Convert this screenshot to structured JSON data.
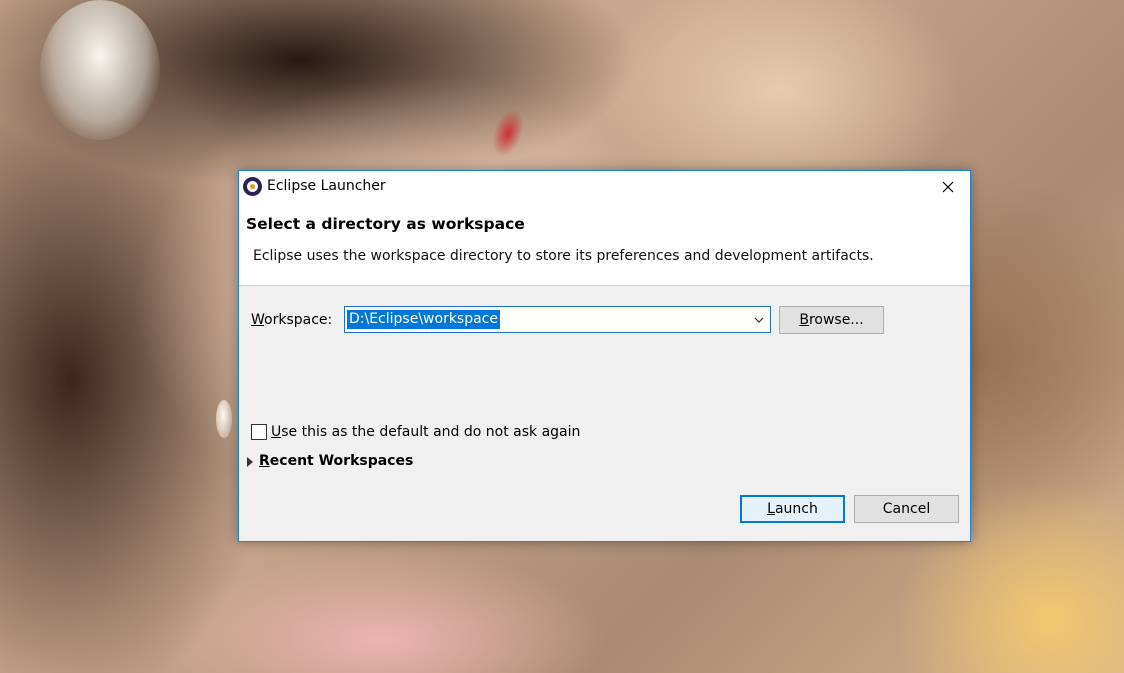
{
  "window": {
    "title": "Eclipse Launcher",
    "icon": "eclipse-icon",
    "close_icon": "close-icon",
    "accent_color": "#1883d7"
  },
  "header": {
    "title": "Select a directory as workspace",
    "description": "Eclipse uses the workspace directory to store its preferences and development artifacts."
  },
  "workspace": {
    "label_mnemonic": "W",
    "label_rest": "orkspace:",
    "value": "D:\\Eclipse\\workspace",
    "dropdown_icon": "chevron-down-icon",
    "browse_mnemonic": "B",
    "browse_rest": "rowse..."
  },
  "default_checkbox": {
    "checked": false,
    "label_mnemonic": "U",
    "label_rest": "se this as the default and do not ask again"
  },
  "recent": {
    "label_mnemonic": "R",
    "label_rest": "ecent Workspaces",
    "expanded": false,
    "toggle_icon": "triangle-right-icon"
  },
  "buttons": {
    "launch_mnemonic": "L",
    "launch_rest": "aunch",
    "cancel": "Cancel"
  }
}
